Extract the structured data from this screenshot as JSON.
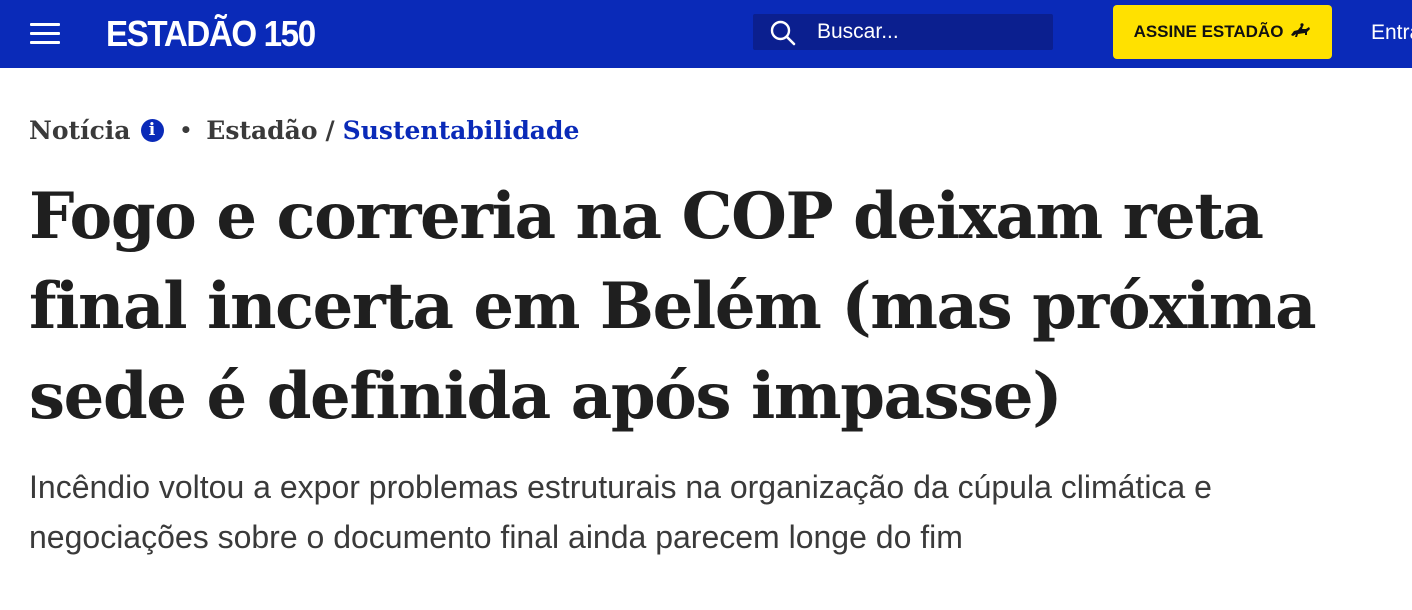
{
  "header": {
    "menu_icon": "hamburger-menu-icon",
    "logo_text": "ESTADÃO 150",
    "search": {
      "icon": "search-icon",
      "placeholder": "Buscar..."
    },
    "subscribe_label": "ASSINE ESTADÃO",
    "subscribe_icon": "horse-rider-icon",
    "login_label": "Entrar"
  },
  "article": {
    "type_label": "Notícia",
    "info_icon": "info-icon",
    "info_glyph": "i",
    "bullet": "•",
    "source": "Estadão",
    "separator": "/",
    "section": "Sustentabilidade",
    "headline": "Fogo e correria na COP deixam reta final incerta em Belém (mas próxima sede é definida após impasse)",
    "subheadline": "Incêndio voltou a expor problemas estruturais na organização da cúpula climática e negociações sobre o documento final ainda parecem longe do fim"
  },
  "colors": {
    "brand_blue": "#0a2ab8",
    "search_bg": "#0b1f8f",
    "subscribe_yellow": "#ffe100",
    "headline_text": "#1f1f1f",
    "body_text": "#3a3a3a"
  }
}
